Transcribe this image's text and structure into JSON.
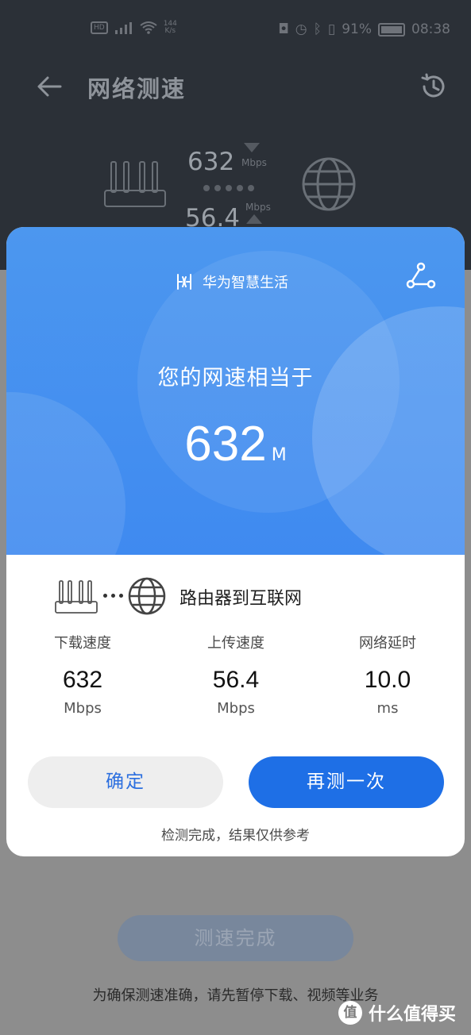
{
  "status_bar": {
    "speed_top": "144",
    "speed_unit": "K/s",
    "battery": "91%",
    "time": "08:38"
  },
  "app": {
    "title": "网络测速",
    "download_value": "632",
    "download_unit": "Mbps",
    "upload_value": "56.4",
    "upload_unit": "Mbps",
    "complete_button": "测速完成",
    "tip": "为确保测速准确，请先暂停下载、视频等业务"
  },
  "dialog": {
    "brand": "华为智慧生活",
    "headline": "您的网速相当于",
    "speed_equiv": "632",
    "speed_equiv_unit": "M",
    "route_label": "路由器到互联网",
    "metrics": [
      {
        "label": "下载速度",
        "value": "632",
        "unit": "Mbps"
      },
      {
        "label": "上传速度",
        "value": "56.4",
        "unit": "Mbps"
      },
      {
        "label": "网络延时",
        "value": "10.0",
        "unit": "ms"
      }
    ],
    "ok_button": "确定",
    "retry_button": "再测一次",
    "note": "检测完成，结果仅供参考"
  },
  "watermark": {
    "badge": "值",
    "text": "什么值得买"
  },
  "colors": {
    "accent_blue": "#1e6fe6",
    "hero_blue": "#4590ef"
  }
}
